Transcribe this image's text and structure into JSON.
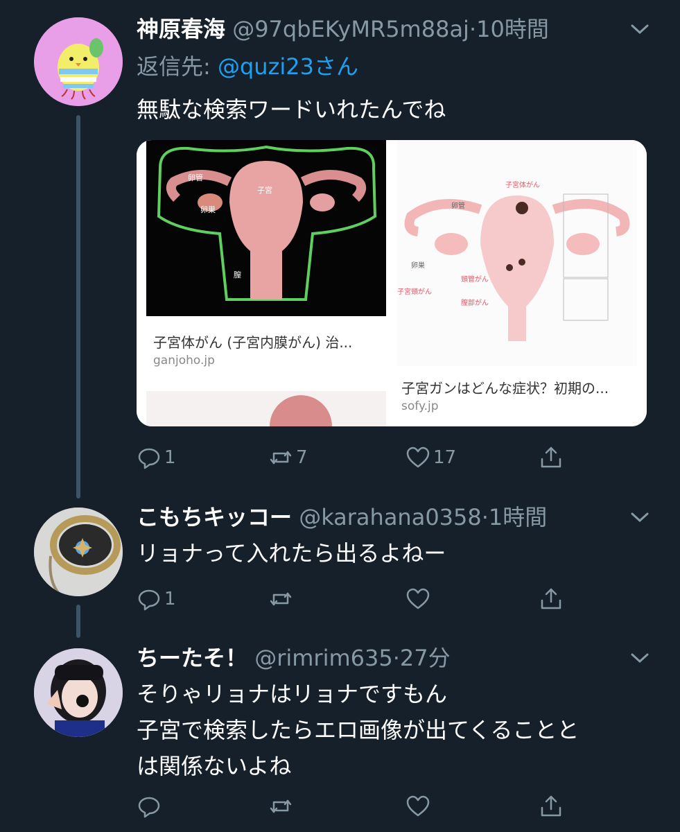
{
  "tweets": [
    {
      "name": "神原春海",
      "handle": "@97qbEKyMR5m88aj",
      "time": "10時間",
      "reply_prefix": "返信先: ",
      "reply_to": "@quzi23さん",
      "text": "無駄な検索ワードいれたんでね",
      "media": {
        "card1": {
          "title": "子宮体がん (子宮内膜がん) 治...",
          "source": "ganjoho.jp",
          "labels": [
            "卵管",
            "子宮",
            "卵巣",
            "膣"
          ]
        },
        "card2": {
          "title": "子宮ガンはどんな症状？初期の...",
          "source": "sofy.jp",
          "labels": [
            "子宮体がん",
            "卵管",
            "卵巣",
            "頸管がん",
            "子宮頸がん",
            "膣部がん"
          ]
        }
      },
      "actions": {
        "reply": "1",
        "retweet": "7",
        "like": "17"
      }
    },
    {
      "name": "こもちキッコー",
      "handle": "@karahana0358",
      "time": "1時間",
      "text": "リョナって入れたら出るよねー",
      "actions": {
        "reply": "1",
        "retweet": "",
        "like": ""
      }
    },
    {
      "name": "ちーたそ！",
      "handle": "@rimrim635",
      "time": "27分",
      "text": "そりゃリョナはリョナですもん\n子宮で検索したらエロ画像が出てくることと\nは関係ないよね",
      "actions": {
        "reply": "",
        "retweet": "",
        "like": ""
      }
    }
  ],
  "colors": {
    "background": "#15202b",
    "secondary_text": "#8899a6",
    "link": "#1da1f2",
    "thread_line": "#3d5466"
  }
}
